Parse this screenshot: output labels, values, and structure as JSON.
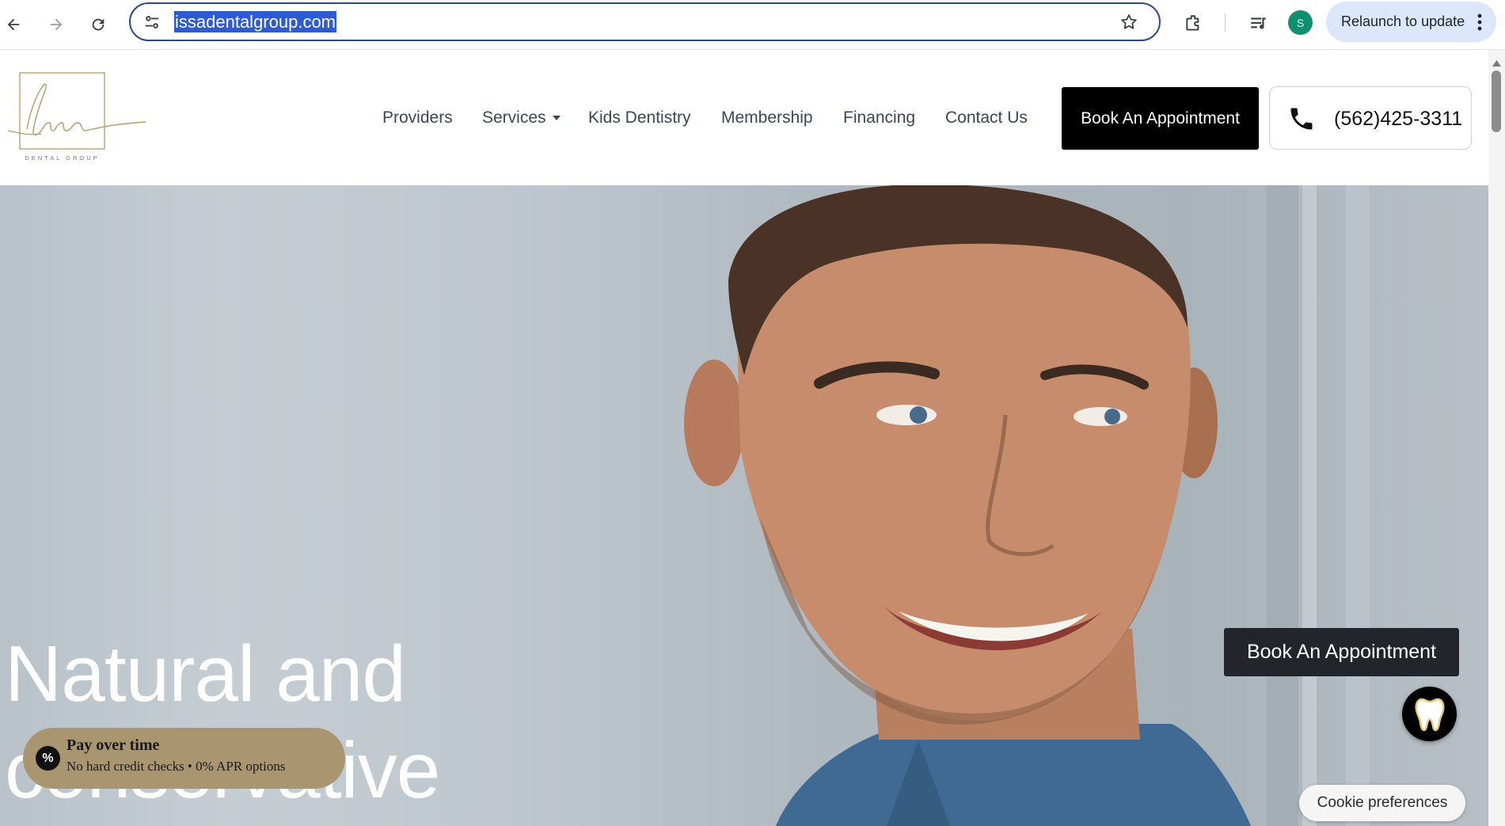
{
  "browser": {
    "url": "issadentalgroup.com",
    "profile_initial": "S",
    "relaunch_label": "Relaunch to update",
    "icons": [
      "back-arrow-icon",
      "forward-arrow-icon",
      "reload-icon",
      "site-settings-icon",
      "bookmark-star-icon",
      "extensions-icon",
      "media-controls-icon",
      "more-vert-icon"
    ]
  },
  "site": {
    "logo": {
      "script": "Issa",
      "subtitle": "DENTAL GROUP"
    },
    "nav": [
      {
        "label": "Providers"
      },
      {
        "label": "Services"
      },
      {
        "label": "Kids Dentistry"
      },
      {
        "label": "Membership"
      },
      {
        "label": "Financing"
      },
      {
        "label": "Contact Us"
      }
    ],
    "book_label": "Book An Appointment",
    "phone": "(562)425-3311"
  },
  "hero": {
    "title_line1": "Natural and",
    "title_line2": "conservative"
  },
  "widgets": {
    "pay_title": "Pay over time",
    "pay_subtitle": "No hard credit checks • 0% APR options",
    "pay_badge": "%",
    "float_book_label": "Book An Appointment",
    "cookie_label": "Cookie preferences"
  },
  "colors": {
    "url_highlight": "#2f5bd1",
    "omnibox_border": "#2c4a8a",
    "relaunch_bg": "#dde7fb",
    "avatar_bg": "#0f8f6d",
    "logo_gold": "#b59a6a",
    "pay_pill_bg": "#a99570",
    "book_btn_bg": "#000000"
  }
}
